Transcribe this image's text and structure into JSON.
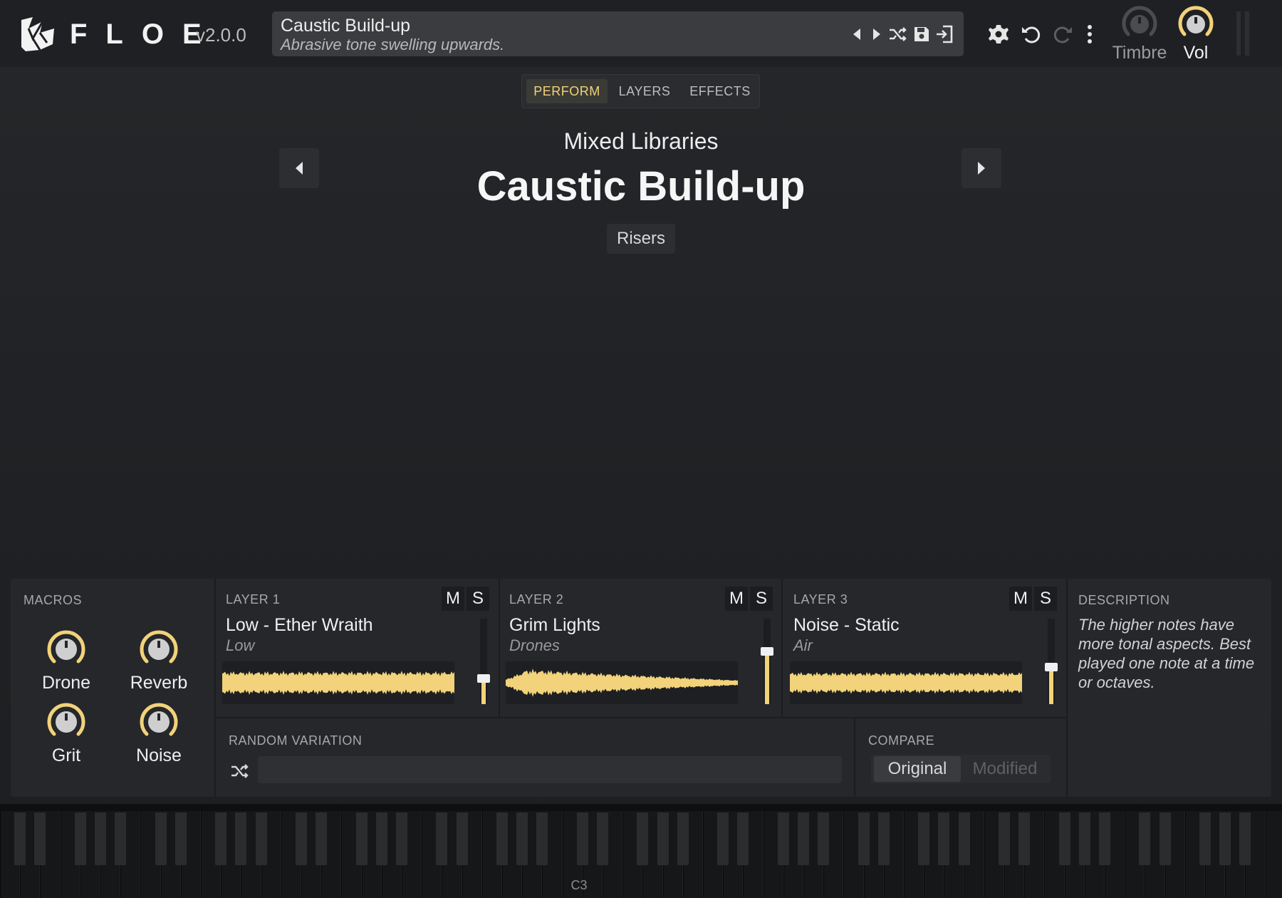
{
  "app": {
    "logo_text": "FLOE",
    "version": "v2.0.0"
  },
  "preset": {
    "name": "Caustic Build-up",
    "description": "Abrasive tone swelling upwards."
  },
  "top_knobs": [
    {
      "label": "Timbre"
    },
    {
      "label": "Vol"
    }
  ],
  "tabs": [
    {
      "label": "PERFORM",
      "active": true
    },
    {
      "label": "LAYERS"
    },
    {
      "label": "EFFECTS"
    }
  ],
  "hero": {
    "library": "Mixed Libraries",
    "title": "Caustic Build-up",
    "tag": "Risers"
  },
  "macros": {
    "label": "MACROS",
    "items": [
      {
        "label": "Drone"
      },
      {
        "label": "Reverb"
      },
      {
        "label": "Grit"
      },
      {
        "label": "Noise"
      }
    ]
  },
  "layers": [
    {
      "label": "LAYER 1",
      "name": "Low - Ether Wraith",
      "sub": "Low",
      "mute": "M",
      "solo": "S",
      "level": 0.3
    },
    {
      "label": "LAYER 2",
      "name": "Grim Lights",
      "sub": "Drones",
      "mute": "M",
      "solo": "S",
      "level": 0.62
    },
    {
      "label": "LAYER 3",
      "name": "Noise - Static",
      "sub": "Air",
      "mute": "M",
      "solo": "S",
      "level": 0.43
    }
  ],
  "random_variation": {
    "label": "RANDOM VARIATION"
  },
  "compare": {
    "label": "COMPARE",
    "original": "Original",
    "modified": "Modified",
    "selected": "Original"
  },
  "description": {
    "label": "DESCRIPTION",
    "text": "The higher notes have more tonal aspects. Best played one note at a time or octaves."
  },
  "keyboard": {
    "c3_label": "C3"
  },
  "colors": {
    "accent": "#f2d27a",
    "background": "#1f2124",
    "panel": "#25272a"
  }
}
